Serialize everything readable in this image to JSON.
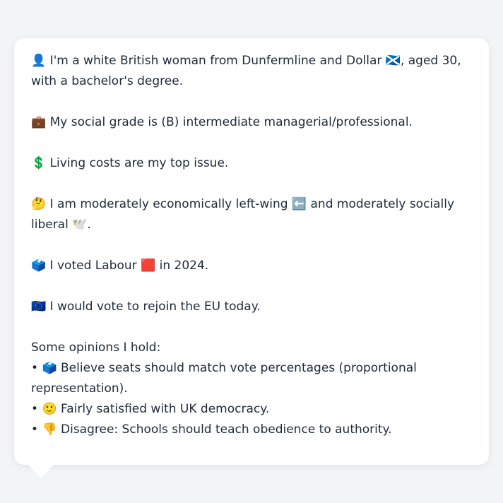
{
  "profile": {
    "identity": {
      "icon": "👤",
      "text_before": "I'm a white British woman from Dunfermline and Dollar",
      "flag": "🏴󠁧󠁢󠁳󠁣󠁴󠁿",
      "text_after": ", aged 30, with a bachelor's degree."
    },
    "social_grade": {
      "icon": "💼",
      "text": "My social grade is (B) intermediate managerial/professional."
    },
    "top_issue": {
      "icon": "💲",
      "text": "Living costs are my top issue."
    },
    "ideology": {
      "icon": "🤔",
      "text_before": "I am moderately economically left-wing",
      "left_icon": "⬅️",
      "text_middle": "and moderately socially liberal",
      "dove_icon": "🕊️",
      "text_after": "."
    },
    "vote_2024": {
      "icon": "🗳️",
      "text_before": "I voted Labour",
      "party_icon": "🟥",
      "text_after": "in 2024."
    },
    "eu": {
      "icon": "🇪🇺",
      "text": "I would vote to rejoin the EU today."
    },
    "opinions": {
      "heading": "Some opinions I hold:",
      "items": [
        {
          "bullet": "•",
          "icon": "🗳️",
          "text": "Believe seats should match vote percentages (proportional representation)."
        },
        {
          "bullet": "•",
          "icon": "🙂",
          "text": "Fairly satisfied with UK democracy."
        },
        {
          "bullet": "•",
          "icon": "👎",
          "text": "Disagree: Schools should teach obedience to authority."
        }
      ]
    }
  }
}
